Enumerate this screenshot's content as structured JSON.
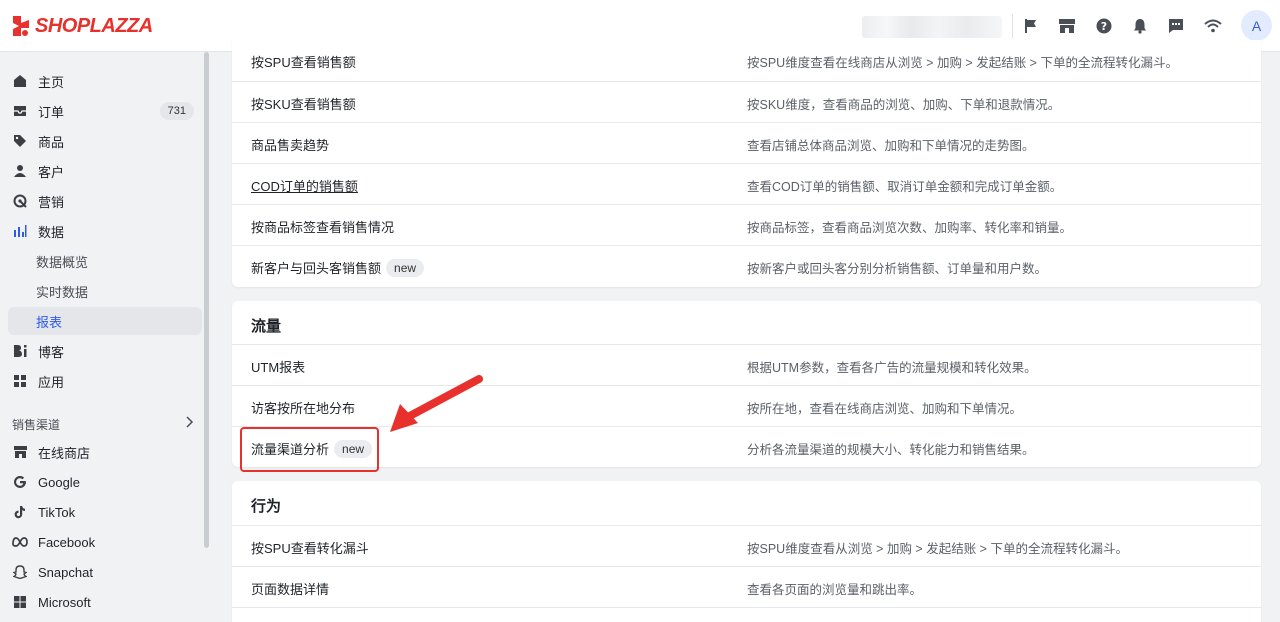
{
  "app": {
    "logo_text": "SHOPLAZZA",
    "accent": "#2f5bea",
    "brand_red": "#e8312d"
  },
  "topbar": {
    "icons": [
      "flag-icon",
      "store-icon",
      "help-icon",
      "bell-icon",
      "message-icon",
      "wifi-icon"
    ],
    "avatar_letter": "A"
  },
  "sidebar": {
    "items": [
      {
        "label": "主页",
        "icon": "home-icon"
      },
      {
        "label": "订单",
        "icon": "order-icon",
        "badge": "731"
      },
      {
        "label": "商品",
        "icon": "tag-icon"
      },
      {
        "label": "客户",
        "icon": "user-icon"
      },
      {
        "label": "营销",
        "icon": "marketing-icon"
      },
      {
        "label": "数据",
        "icon": "chart-icon"
      },
      {
        "label": "数据概览"
      },
      {
        "label": "实时数据"
      },
      {
        "label": "报表"
      },
      {
        "label": "博客",
        "icon": "blog-icon"
      },
      {
        "label": "应用",
        "icon": "apps-icon"
      }
    ],
    "channels_label": "销售渠道",
    "channels": [
      {
        "label": "在线商店",
        "icon": "store-icon"
      },
      {
        "label": "Google",
        "icon": "google-icon"
      },
      {
        "label": "TikTok",
        "icon": "tiktok-icon"
      },
      {
        "label": "Facebook",
        "icon": "meta-icon"
      },
      {
        "label": "Snapchat",
        "icon": "snapchat-icon"
      },
      {
        "label": "Microsoft",
        "icon": "microsoft-icon"
      }
    ]
  },
  "main": {
    "sales_rows": [
      {
        "name": "按SPU查看销售额",
        "desc": "按SPU维度查看在线商店从浏览 > 加购 > 发起结账 > 下单的全流程转化漏斗。"
      },
      {
        "name": "按SKU查看销售额",
        "desc": "按SKU维度，查看商品的浏览、加购、下单和退款情况。"
      },
      {
        "name": "商品售卖趋势",
        "desc": "查看店铺总体商品浏览、加购和下单情况的走势图。"
      },
      {
        "name": "COD订单的销售额",
        "desc": "查看COD订单的销售额、取消订单金额和完成订单金额。"
      },
      {
        "name": "按商品标签查看销售情况",
        "desc": "按商品标签，查看商品浏览次数、加购率、转化率和销量。"
      },
      {
        "name": "新客户与回头客销售额",
        "desc": "按新客户或回头客分别分析销售额、订单量和用户数。",
        "tag": "new"
      }
    ],
    "traffic": {
      "title": "流量",
      "rows": [
        {
          "name": "UTM报表",
          "desc": "根据UTM参数，查看各广告的流量规模和转化效果。"
        },
        {
          "name": "访客按所在地分布",
          "desc": "按所在地，查看在线商店浏览、加购和下单情况。"
        },
        {
          "name": "流量渠道分析",
          "desc": "分析各流量渠道的规模大小、转化能力和销售结果。",
          "tag": "new"
        }
      ]
    },
    "behavior": {
      "title": "行为",
      "rows": [
        {
          "name": "按SPU查看转化漏斗",
          "desc": "按SPU维度查看从浏览 > 加购 > 发起结账 > 下单的全流程转化漏斗。"
        },
        {
          "name": "页面数据详情",
          "desc": "查看各页面的浏览量和跳出率。"
        }
      ]
    }
  }
}
